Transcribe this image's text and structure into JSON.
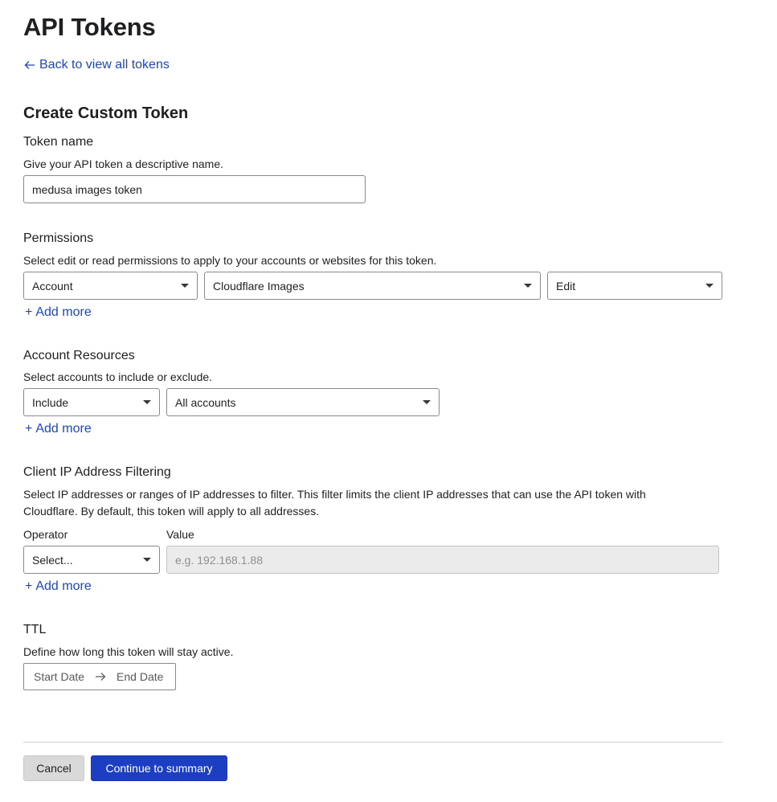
{
  "page": {
    "title": "API Tokens",
    "back_link": "Back to view all tokens"
  },
  "form": {
    "heading": "Create Custom Token",
    "token_name": {
      "label": "Token name",
      "help": "Give your API token a descriptive name.",
      "value": "medusa images token"
    },
    "permissions": {
      "label": "Permissions",
      "help": "Select edit or read permissions to apply to your accounts or websites for this token.",
      "scope": "Account",
      "resource": "Cloudflare Images",
      "access": "Edit",
      "add_more": "Add more"
    },
    "account_resources": {
      "label": "Account Resources",
      "help": "Select accounts to include or exclude.",
      "mode": "Include",
      "target": "All accounts",
      "add_more": "Add more"
    },
    "ip_filtering": {
      "label": "Client IP Address Filtering",
      "help_line1": "Select IP addresses or ranges of IP addresses to filter. This filter limits the client IP addresses that can use the API token with",
      "help_line2": "Cloudflare. By default, this token will apply to all addresses.",
      "operator_label": "Operator",
      "value_label": "Value",
      "operator_value": "Select...",
      "value_placeholder": "e.g. 192.168.1.88",
      "add_more": "Add more"
    },
    "ttl": {
      "label": "TTL",
      "help": "Define how long this token will stay active.",
      "start": "Start Date",
      "end": "End Date"
    }
  },
  "actions": {
    "cancel": "Cancel",
    "continue": "Continue to summary"
  },
  "colors": {
    "link": "#1c45c3",
    "primary_button": "#1c3ec2",
    "text": "#1d1f20"
  },
  "icons": {
    "back": "arrow-left-icon",
    "add": "plus-icon",
    "range": "arrow-right-icon",
    "dropdown": "caret-down-icon"
  }
}
